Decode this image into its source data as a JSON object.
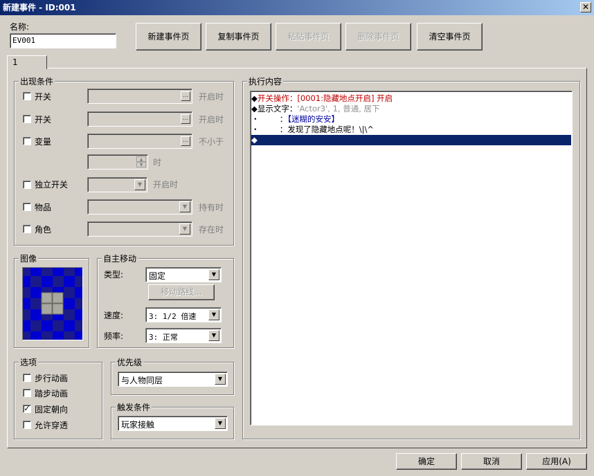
{
  "window": {
    "title": "新建事件 - ID:001",
    "close_glyph": "✕"
  },
  "name_field": {
    "label": "名称:",
    "value": "EV001"
  },
  "page_buttons": [
    "新建事件页",
    "复制事件页",
    "粘贴事件页",
    "删除事件页",
    "清空事件页"
  ],
  "tabs": [
    "1"
  ],
  "conditions": {
    "title": "出现条件",
    "rows": [
      {
        "label": "开关",
        "suffix": "开启时"
      },
      {
        "label": "开关",
        "suffix": "开启时"
      },
      {
        "label": "变量",
        "suffix": "不小于"
      },
      {
        "label": "",
        "suffix": "时"
      },
      {
        "label": "独立开关",
        "suffix": "开启时"
      },
      {
        "label": "物品",
        "suffix": "持有时"
      },
      {
        "label": "角色",
        "suffix": "存在时"
      }
    ],
    "dots": "..."
  },
  "image": {
    "title": "图像",
    "grid_colors": [
      "#1a1a8a",
      "#0000d0"
    ],
    "sprite_color": "#a8a8a0"
  },
  "autonomous_movement": {
    "title": "自主移动",
    "type_label": "类型:",
    "type_value": "固定",
    "route_button": "移动路线...",
    "speed_label": "速度:",
    "speed_value": "3: 1/2 倍速",
    "freq_label": "频率:",
    "freq_value": "3: 正常"
  },
  "options": {
    "title": "选项",
    "items": [
      {
        "label": "步行动画",
        "checked": false
      },
      {
        "label": "踏步动画",
        "checked": false
      },
      {
        "label": "固定朝向",
        "checked": true
      },
      {
        "label": "允许穿透",
        "checked": false
      }
    ],
    "check_glyph": "✓"
  },
  "priority": {
    "title": "优先级",
    "value": "与人物同层"
  },
  "trigger": {
    "title": "触发条件",
    "value": "玩家接触"
  },
  "execution": {
    "title": "执行内容",
    "commands": [
      {
        "bullet": "◆",
        "parts": [
          {
            "text": "开关操作：[0001:隐藏地点开启] 开启",
            "color": "#c00000"
          }
        ]
      },
      {
        "bullet": "◆",
        "parts": [
          {
            "text": "显示文字：",
            "color": "#000000"
          },
          {
            "text": "'Actor3', 1, 普通, 居下",
            "color": "#909090"
          }
        ]
      },
      {
        "bullet": "・",
        "parts": [
          {
            "text": "        ：",
            "color": "#000000"
          },
          {
            "text": "【迷糊的安安】",
            "color": "#0000a0"
          }
        ]
      },
      {
        "bullet": "・",
        "parts": [
          {
            "text": "        ：",
            "color": "#000000"
          },
          {
            "text": "发现了隐藏地点呢！\\|\\^",
            "color": "#000000"
          }
        ]
      },
      {
        "bullet": "◆",
        "parts": []
      }
    ],
    "selected_index": 4,
    "selection_color": "#0a246a"
  },
  "footer": {
    "ok": "确定",
    "cancel": "取消",
    "apply": "应用(A)"
  },
  "combo_arrow": "▼",
  "spin_up": "▲",
  "spin_down": "▼"
}
